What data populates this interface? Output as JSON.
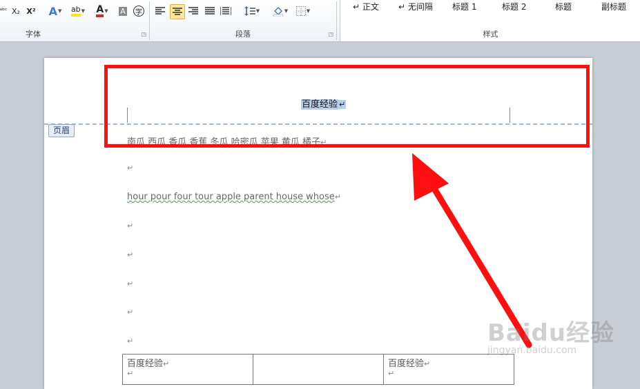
{
  "ribbon": {
    "font_group": {
      "label": "字体",
      "tools": {
        "strike": "ᵃᵇᶜ",
        "subscript": "X₂",
        "superscript": "X²",
        "text_effect": "A",
        "highlight": "ab",
        "font_color": "A",
        "char_shading": "A",
        "enclose_char": "字"
      }
    },
    "paragraph_group": {
      "label": "段落"
    },
    "styles_group": {
      "label": "样式",
      "items": [
        "↵ 正文",
        "↵ 无间隔",
        "标题 1",
        "标题 2",
        "标题",
        "副标题"
      ]
    }
  },
  "document": {
    "header": {
      "text": "百度经验",
      "tag": "页眉"
    },
    "lines": {
      "fruits": "南瓜  西瓜  香瓜  香蕉  冬瓜  哈密瓜  苹果  黄瓜  橘子",
      "english": "hour pour four tour apple parent house whose"
    },
    "paragraph_mark": "↵",
    "table": {
      "rows": [
        [
          "百度经验",
          "",
          "百度经验"
        ]
      ]
    }
  },
  "watermark": {
    "logo": "Baidu经验",
    "url": "jingyan.baidu.com"
  },
  "colors": {
    "annotation_red": "#ff0f0f",
    "selection_blue": "#b7cde9",
    "header_line": "#9db5d6"
  }
}
